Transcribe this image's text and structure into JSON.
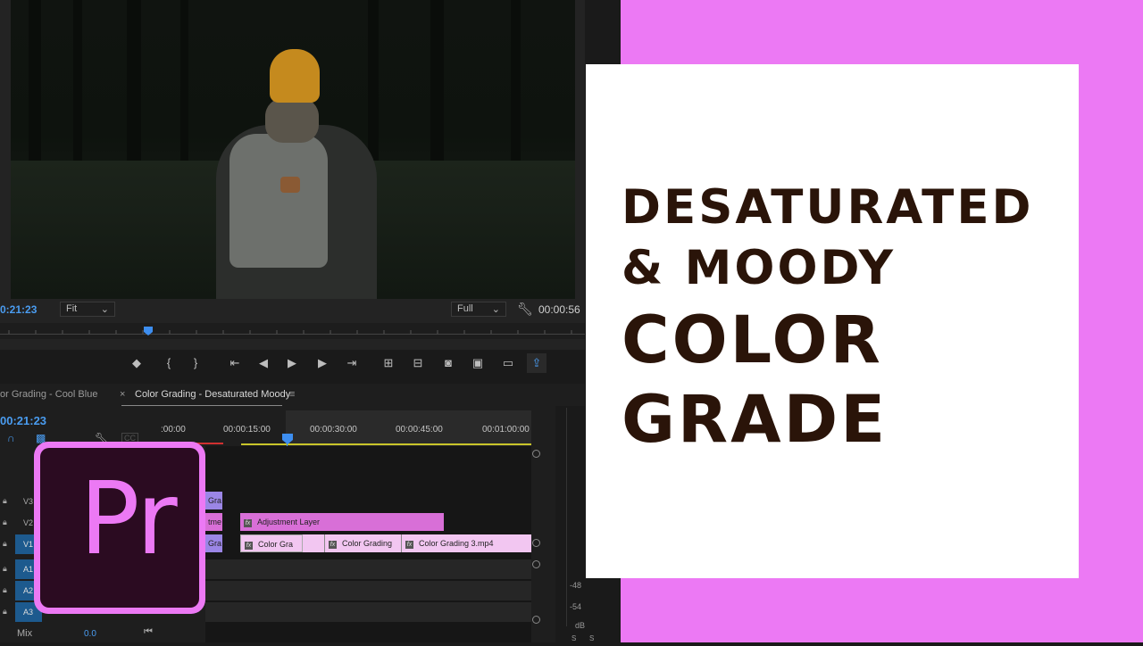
{
  "monitor": {
    "timecode_current": "0:21:23",
    "fit_label": "Fit",
    "quality_label": "Full",
    "timecode_duration": "00:00:56"
  },
  "timeline": {
    "tabs": [
      {
        "label": "or Grading - Cool Blue"
      },
      {
        "label": "Color Grading - Desaturated Moody"
      }
    ],
    "playhead_timecode": "00:21:23",
    "ruler": [
      ":00:00",
      "00:00:15:00",
      "00:00:30:00",
      "00:00:45:00",
      "00:01:00:00"
    ],
    "tracks": {
      "v3": "V3",
      "v2": "V2",
      "v1": "V1",
      "a1": "A1",
      "a2": "A2",
      "a3": "A3",
      "mix": "Mix",
      "mix_value": "0.0"
    },
    "clips": {
      "v3_left": "Gra",
      "v2_left": "tme",
      "v2_adjustment": "Adjustment Layer",
      "v1_left": "Gra",
      "v1_clip1": "Color Gra",
      "v1_clip2": "Color Grading",
      "v1_clip3": "Color Grading 3.mp4"
    }
  },
  "meter": {
    "labels": [
      "-48",
      "-54",
      "dB"
    ],
    "buttons": [
      "S",
      "S"
    ]
  },
  "title": {
    "line1": "DESATURATED",
    "line2": "& MOODY",
    "line3": "COLOR",
    "line4": "GRADE"
  },
  "logo": {
    "text": "Pr"
  },
  "colors": {
    "accent_pink": "#ec79f4",
    "heading_brown": "#2a1409",
    "timecode_blue": "#4a9cf0",
    "clip_violet": "#9b86e6",
    "clip_pink": "#d86fd7",
    "clip_light": "#f2c6f1"
  }
}
